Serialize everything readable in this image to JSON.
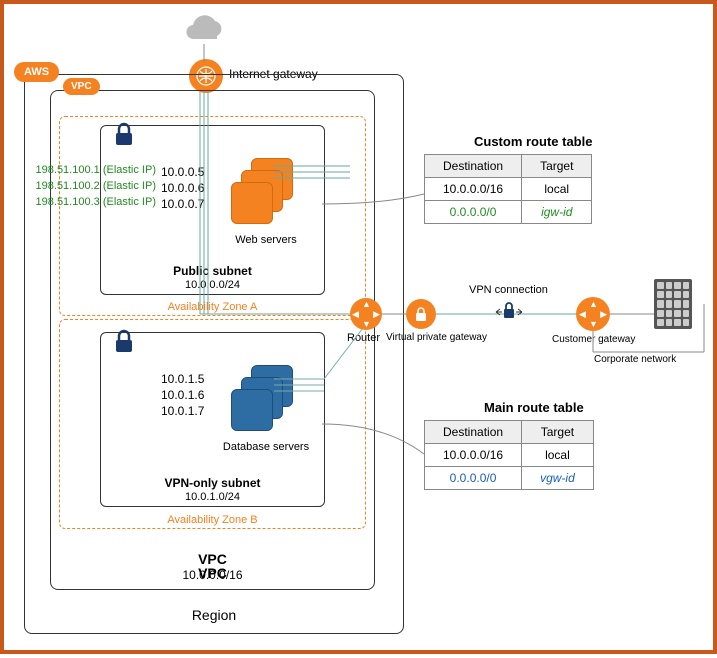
{
  "cloud_label": "Internet gateway",
  "aws_badge": "AWS",
  "vpc_badge": "VPC",
  "region_label": "Region",
  "vpc": {
    "label": "VPC",
    "cidr": "10.0.0.0/16"
  },
  "az_a": {
    "label": "Availability Zone A"
  },
  "az_b": {
    "label": "Availability Zone B"
  },
  "public_subnet": {
    "label": "Public subnet",
    "cidr": "10.0.0.0/24",
    "servers_label": "Web servers",
    "ips": [
      "10.0.0.5",
      "10.0.0.6",
      "10.0.0.7"
    ],
    "elastic_ips": [
      "198.51.100.1 (Elastic IP)",
      "198.51.100.2 (Elastic IP)",
      "198.51.100.3 (Elastic IP)"
    ]
  },
  "vpn_subnet": {
    "label": "VPN-only subnet",
    "cidr": "10.0.1.0/24",
    "servers_label": "Database servers",
    "ips": [
      "10.0.1.5",
      "10.0.1.6",
      "10.0.1.7"
    ]
  },
  "router_label": "Router",
  "vpg_label": "Virtual private gateway",
  "vpn_conn_label": "VPN connection",
  "cgw_label": "Customer gateway",
  "corp_label": "Corporate network",
  "custom_route_table": {
    "title": "Custom route table",
    "headers": [
      "Destination",
      "Target"
    ],
    "rows": [
      {
        "dest": "10.0.0.0/16",
        "target": "local",
        "style": "normal"
      },
      {
        "dest": "0.0.0.0/0",
        "target": "igw-id",
        "style": "green"
      }
    ]
  },
  "main_route_table": {
    "title": "Main route table",
    "headers": [
      "Destination",
      "Target"
    ],
    "rows": [
      {
        "dest": "10.0.0.0/16",
        "target": "local",
        "style": "normal"
      },
      {
        "dest": "0.0.0.0/0",
        "target": "vgw-id",
        "style": "blue"
      }
    ]
  },
  "colors": {
    "orange": "#f58220",
    "green": "#228B22",
    "blue": "#1a5fb4"
  }
}
